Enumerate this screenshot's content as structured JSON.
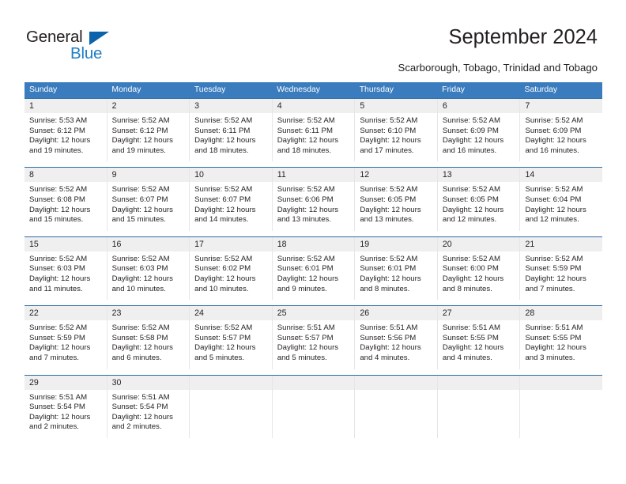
{
  "logo": {
    "word_top": "General",
    "word_bottom": "Blue",
    "triangle_color": "#0a63ab",
    "blue_color": "#1f7ec4",
    "dark_color": "#231f20"
  },
  "header": {
    "title": "September 2024",
    "subtitle": "Scarborough, Tobago, Trinidad and Tobago"
  },
  "theme": {
    "header_bg": "#3a7cbe",
    "header_text": "#ffffff",
    "week_rule": "#2e6da4",
    "daynum_bg": "#efefef",
    "cell_bg": "#ffffff",
    "text": "#231f20"
  },
  "calendar": {
    "weekdays": [
      "Sunday",
      "Monday",
      "Tuesday",
      "Wednesday",
      "Thursday",
      "Friday",
      "Saturday"
    ],
    "weeks": [
      [
        {
          "day": "1",
          "sunrise": "Sunrise: 5:53 AM",
          "sunset": "Sunset: 6:12 PM",
          "daylight1": "Daylight: 12 hours",
          "daylight2": "and 19 minutes."
        },
        {
          "day": "2",
          "sunrise": "Sunrise: 5:52 AM",
          "sunset": "Sunset: 6:12 PM",
          "daylight1": "Daylight: 12 hours",
          "daylight2": "and 19 minutes."
        },
        {
          "day": "3",
          "sunrise": "Sunrise: 5:52 AM",
          "sunset": "Sunset: 6:11 PM",
          "daylight1": "Daylight: 12 hours",
          "daylight2": "and 18 minutes."
        },
        {
          "day": "4",
          "sunrise": "Sunrise: 5:52 AM",
          "sunset": "Sunset: 6:11 PM",
          "daylight1": "Daylight: 12 hours",
          "daylight2": "and 18 minutes."
        },
        {
          "day": "5",
          "sunrise": "Sunrise: 5:52 AM",
          "sunset": "Sunset: 6:10 PM",
          "daylight1": "Daylight: 12 hours",
          "daylight2": "and 17 minutes."
        },
        {
          "day": "6",
          "sunrise": "Sunrise: 5:52 AM",
          "sunset": "Sunset: 6:09 PM",
          "daylight1": "Daylight: 12 hours",
          "daylight2": "and 16 minutes."
        },
        {
          "day": "7",
          "sunrise": "Sunrise: 5:52 AM",
          "sunset": "Sunset: 6:09 PM",
          "daylight1": "Daylight: 12 hours",
          "daylight2": "and 16 minutes."
        }
      ],
      [
        {
          "day": "8",
          "sunrise": "Sunrise: 5:52 AM",
          "sunset": "Sunset: 6:08 PM",
          "daylight1": "Daylight: 12 hours",
          "daylight2": "and 15 minutes."
        },
        {
          "day": "9",
          "sunrise": "Sunrise: 5:52 AM",
          "sunset": "Sunset: 6:07 PM",
          "daylight1": "Daylight: 12 hours",
          "daylight2": "and 15 minutes."
        },
        {
          "day": "10",
          "sunrise": "Sunrise: 5:52 AM",
          "sunset": "Sunset: 6:07 PM",
          "daylight1": "Daylight: 12 hours",
          "daylight2": "and 14 minutes."
        },
        {
          "day": "11",
          "sunrise": "Sunrise: 5:52 AM",
          "sunset": "Sunset: 6:06 PM",
          "daylight1": "Daylight: 12 hours",
          "daylight2": "and 13 minutes."
        },
        {
          "day": "12",
          "sunrise": "Sunrise: 5:52 AM",
          "sunset": "Sunset: 6:05 PM",
          "daylight1": "Daylight: 12 hours",
          "daylight2": "and 13 minutes."
        },
        {
          "day": "13",
          "sunrise": "Sunrise: 5:52 AM",
          "sunset": "Sunset: 6:05 PM",
          "daylight1": "Daylight: 12 hours",
          "daylight2": "and 12 minutes."
        },
        {
          "day": "14",
          "sunrise": "Sunrise: 5:52 AM",
          "sunset": "Sunset: 6:04 PM",
          "daylight1": "Daylight: 12 hours",
          "daylight2": "and 12 minutes."
        }
      ],
      [
        {
          "day": "15",
          "sunrise": "Sunrise: 5:52 AM",
          "sunset": "Sunset: 6:03 PM",
          "daylight1": "Daylight: 12 hours",
          "daylight2": "and 11 minutes."
        },
        {
          "day": "16",
          "sunrise": "Sunrise: 5:52 AM",
          "sunset": "Sunset: 6:03 PM",
          "daylight1": "Daylight: 12 hours",
          "daylight2": "and 10 minutes."
        },
        {
          "day": "17",
          "sunrise": "Sunrise: 5:52 AM",
          "sunset": "Sunset: 6:02 PM",
          "daylight1": "Daylight: 12 hours",
          "daylight2": "and 10 minutes."
        },
        {
          "day": "18",
          "sunrise": "Sunrise: 5:52 AM",
          "sunset": "Sunset: 6:01 PM",
          "daylight1": "Daylight: 12 hours",
          "daylight2": "and 9 minutes."
        },
        {
          "day": "19",
          "sunrise": "Sunrise: 5:52 AM",
          "sunset": "Sunset: 6:01 PM",
          "daylight1": "Daylight: 12 hours",
          "daylight2": "and 8 minutes."
        },
        {
          "day": "20",
          "sunrise": "Sunrise: 5:52 AM",
          "sunset": "Sunset: 6:00 PM",
          "daylight1": "Daylight: 12 hours",
          "daylight2": "and 8 minutes."
        },
        {
          "day": "21",
          "sunrise": "Sunrise: 5:52 AM",
          "sunset": "Sunset: 5:59 PM",
          "daylight1": "Daylight: 12 hours",
          "daylight2": "and 7 minutes."
        }
      ],
      [
        {
          "day": "22",
          "sunrise": "Sunrise: 5:52 AM",
          "sunset": "Sunset: 5:59 PM",
          "daylight1": "Daylight: 12 hours",
          "daylight2": "and 7 minutes."
        },
        {
          "day": "23",
          "sunrise": "Sunrise: 5:52 AM",
          "sunset": "Sunset: 5:58 PM",
          "daylight1": "Daylight: 12 hours",
          "daylight2": "and 6 minutes."
        },
        {
          "day": "24",
          "sunrise": "Sunrise: 5:52 AM",
          "sunset": "Sunset: 5:57 PM",
          "daylight1": "Daylight: 12 hours",
          "daylight2": "and 5 minutes."
        },
        {
          "day": "25",
          "sunrise": "Sunrise: 5:51 AM",
          "sunset": "Sunset: 5:57 PM",
          "daylight1": "Daylight: 12 hours",
          "daylight2": "and 5 minutes."
        },
        {
          "day": "26",
          "sunrise": "Sunrise: 5:51 AM",
          "sunset": "Sunset: 5:56 PM",
          "daylight1": "Daylight: 12 hours",
          "daylight2": "and 4 minutes."
        },
        {
          "day": "27",
          "sunrise": "Sunrise: 5:51 AM",
          "sunset": "Sunset: 5:55 PM",
          "daylight1": "Daylight: 12 hours",
          "daylight2": "and 4 minutes."
        },
        {
          "day": "28",
          "sunrise": "Sunrise: 5:51 AM",
          "sunset": "Sunset: 5:55 PM",
          "daylight1": "Daylight: 12 hours",
          "daylight2": "and 3 minutes."
        }
      ],
      [
        {
          "day": "29",
          "sunrise": "Sunrise: 5:51 AM",
          "sunset": "Sunset: 5:54 PM",
          "daylight1": "Daylight: 12 hours",
          "daylight2": "and 2 minutes."
        },
        {
          "day": "30",
          "sunrise": "Sunrise: 5:51 AM",
          "sunset": "Sunset: 5:54 PM",
          "daylight1": "Daylight: 12 hours",
          "daylight2": "and 2 minutes."
        },
        {
          "day": "",
          "sunrise": "",
          "sunset": "",
          "daylight1": "",
          "daylight2": ""
        },
        {
          "day": "",
          "sunrise": "",
          "sunset": "",
          "daylight1": "",
          "daylight2": ""
        },
        {
          "day": "",
          "sunrise": "",
          "sunset": "",
          "daylight1": "",
          "daylight2": ""
        },
        {
          "day": "",
          "sunrise": "",
          "sunset": "",
          "daylight1": "",
          "daylight2": ""
        },
        {
          "day": "",
          "sunrise": "",
          "sunset": "",
          "daylight1": "",
          "daylight2": ""
        }
      ]
    ]
  }
}
